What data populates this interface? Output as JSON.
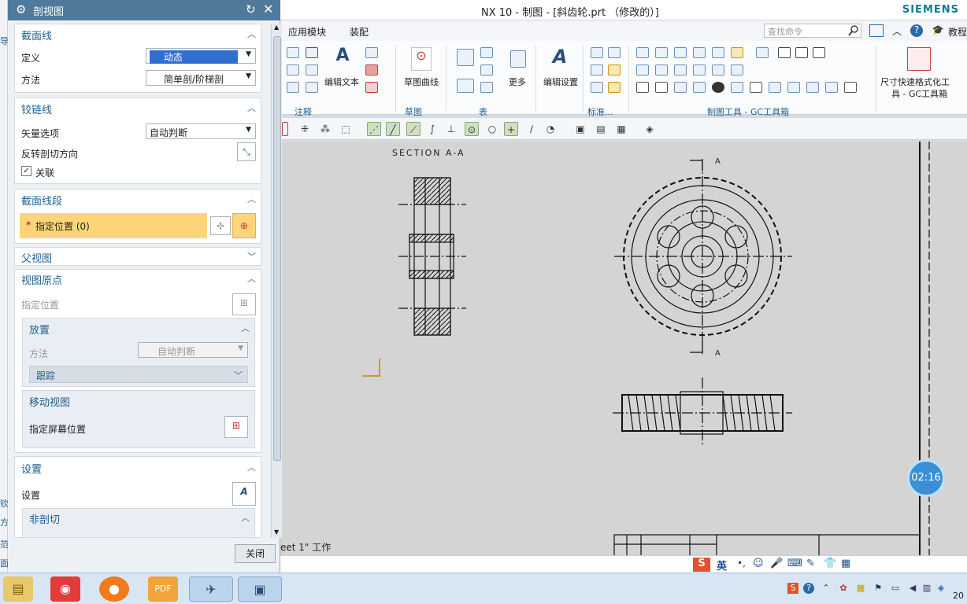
{
  "window": {
    "title": "NX 10 - 制图 - [斜齿轮.prt （修改的）]",
    "brand": "SIEMENS"
  },
  "menu": {
    "items": [
      "应用模块",
      "装配"
    ],
    "search_placeholder": "查找命令",
    "tutorial": "教程"
  },
  "ribbon": {
    "edit_text": "编辑文本",
    "sketch_curve": "草图曲线",
    "more": "更多",
    "edit_settings": "编辑设置",
    "dim_format": "尺寸快速格式化工",
    "dim_format2": "具 - GC工具箱",
    "groups": {
      "annotation": "注释",
      "sketch": "草图",
      "table": "表",
      "standard": "标准...",
      "gc": "制图工具 - GC工具箱"
    }
  },
  "dialog": {
    "title": "剖视图",
    "section_line": {
      "header": "截面线",
      "define_label": "定义",
      "define_value": "动态",
      "method_label": "方法",
      "method_value": "简单剖/阶梯剖"
    },
    "hinge_line": {
      "header": "铰链线",
      "vector_label": "矢量选项",
      "vector_value": "自动判断",
      "reverse_label": "反转剖切方向",
      "associative_label": "关联",
      "associative_checked": true
    },
    "section_segment": {
      "header": "截面线段",
      "specify_location": "指定位置 (0)",
      "required_mark": "*"
    },
    "parent_view": {
      "header": "父视图"
    },
    "view_origin": {
      "header": "视图原点",
      "specify_location": "指定位置",
      "placement": {
        "header": "放置",
        "method_label": "方法",
        "method_value": "自动判断",
        "track": "跟踪"
      },
      "move_view": {
        "header": "移动视图",
        "specify_screen": "指定屏幕位置"
      }
    },
    "settings": {
      "header": "设置",
      "settings_label": "设置",
      "non_section": "非剖切"
    },
    "close_button": "关闭"
  },
  "canvas": {
    "section_label": "SECTION  A-A",
    "arrow_top": "A",
    "arrow_bottom": "A",
    "sheet_status": "eet 1\" 工作"
  },
  "timer": "02:16",
  "ime": {
    "lang": "英"
  },
  "left_strip": [
    "导",
    "钦",
    "方",
    "范",
    "面"
  ],
  "taskbar": {
    "clock": "20"
  }
}
